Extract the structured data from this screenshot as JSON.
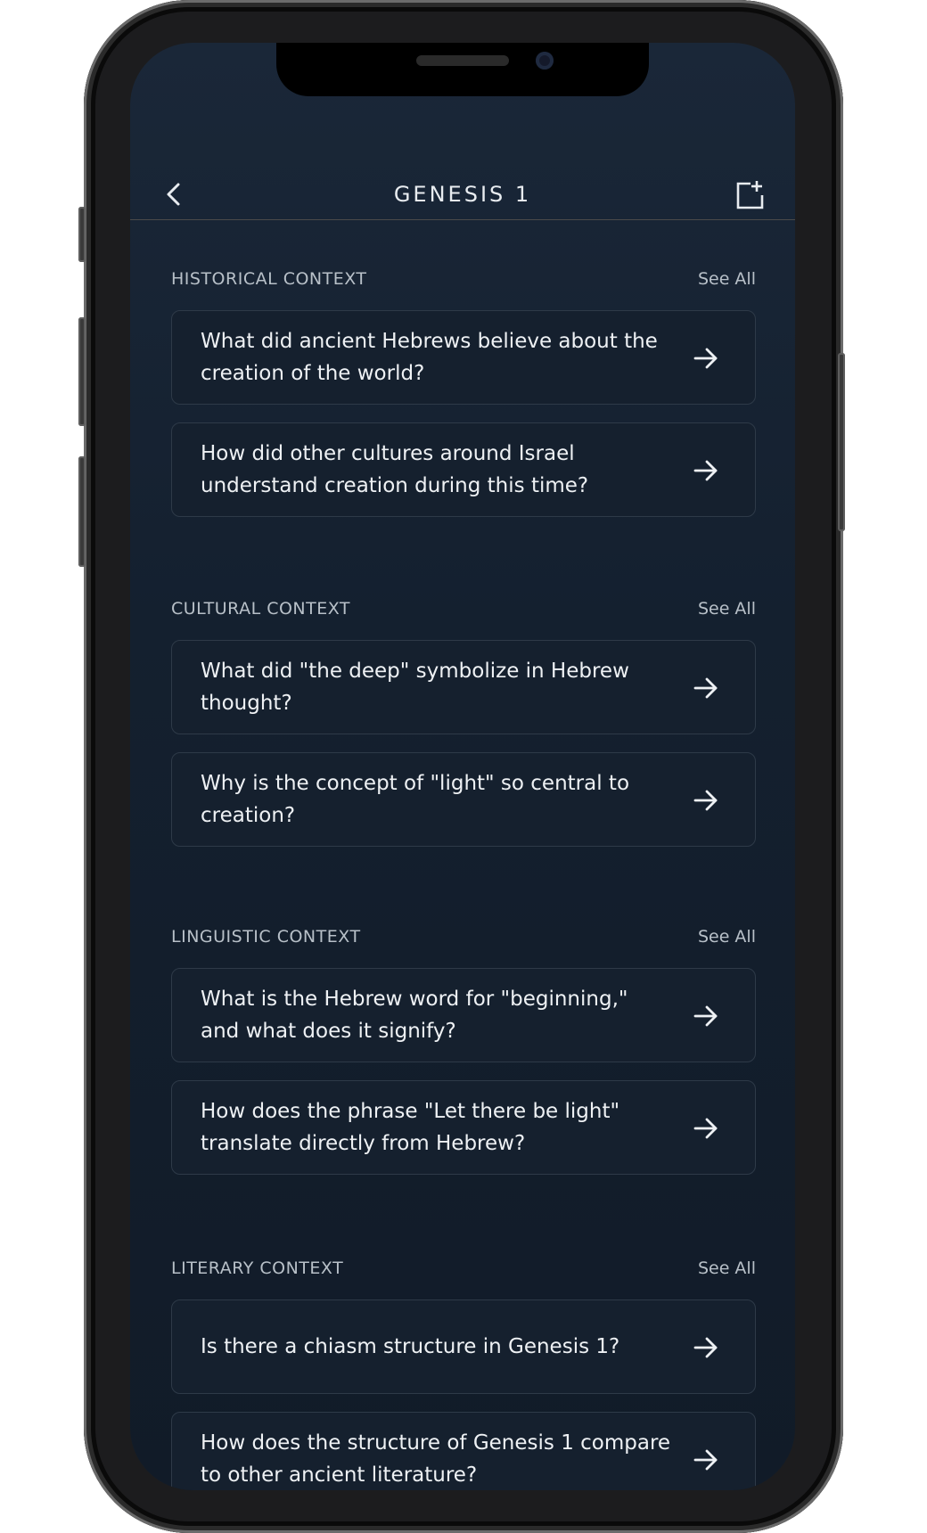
{
  "nav": {
    "title": "GENESIS 1",
    "back_icon": "chevron-left-icon",
    "bookmark_icon": "bookmark-add-icon"
  },
  "sections": [
    {
      "title": "HISTORICAL CONTEXT",
      "see_all": "See All",
      "questions": [
        "What did ancient Hebrews believe about the creation of the world?",
        "How did other cultures around Israel understand creation during this time?"
      ]
    },
    {
      "title": "CULTURAL CONTEXT",
      "see_all": "See All",
      "questions": [
        "What did \"the deep\" symbolize in Hebrew thought?",
        "Why is the concept of \"light\" so central to creation?"
      ]
    },
    {
      "title": "LINGUISTIC CONTEXT",
      "see_all": "See All",
      "questions": [
        "What is the Hebrew word for \"beginning,\" and what does it signify?",
        "How does the phrase \"Let there be light\" translate directly from Hebrew?"
      ]
    },
    {
      "title": "LITERARY CONTEXT",
      "see_all": "See All",
      "questions": [
        "Is there a chiasm structure in Genesis 1?",
        "How does the structure of Genesis 1 compare to other ancient literature?"
      ]
    }
  ],
  "colors": {
    "background": "#14202f",
    "card": "#15202e",
    "card_border": "#2e3a48",
    "text": "#eef1f4",
    "muted": "#b8c0c8"
  }
}
